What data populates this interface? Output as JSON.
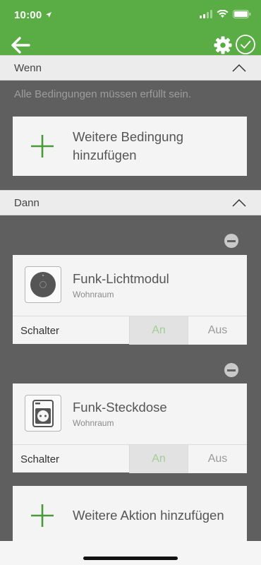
{
  "status": {
    "time": "10:00"
  },
  "appbar": {
    "back_label": "back",
    "settings_label": "settings",
    "confirm_label": "confirm"
  },
  "when": {
    "header": "Wenn",
    "hint": "Alle Bedingungen müssen erfüllt sein.",
    "add_condition": "Weitere Bedingung hinzufügen"
  },
  "then": {
    "header": "Dann",
    "devices": [
      {
        "name": "Funk-Lichtmodul",
        "room": "Wohnraum",
        "switch_label": "Schalter",
        "on_label": "An",
        "off_label": "Aus",
        "selected": "An",
        "icon": "light-module-icon"
      },
      {
        "name": "Funk-Steckdose",
        "room": "Wohnraum",
        "switch_label": "Schalter",
        "on_label": "An",
        "off_label": "Aus",
        "selected": "An",
        "icon": "socket-icon"
      }
    ],
    "add_action": "Weitere Aktion hinzufügen"
  },
  "colors": {
    "brand": "#5aac44",
    "background": "#5f5f5f",
    "card": "#f4f4f4",
    "active_text": "#a3cd95"
  }
}
